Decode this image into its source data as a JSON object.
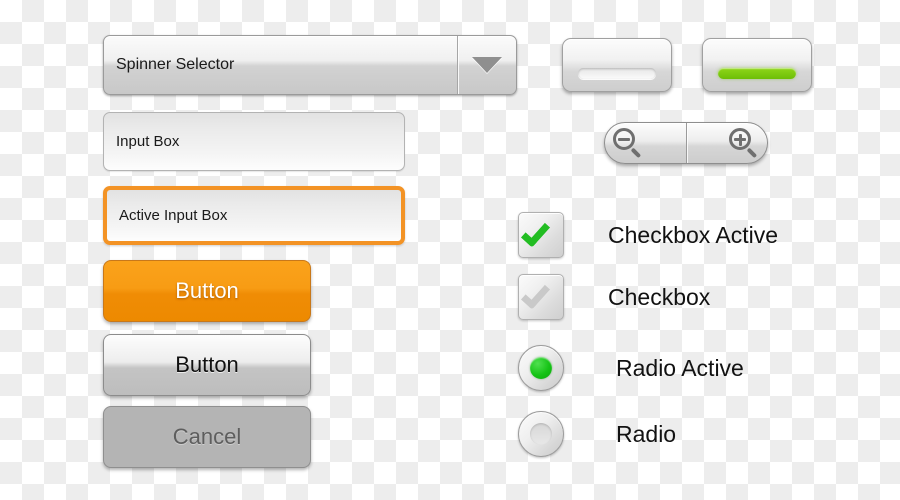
{
  "palette": {
    "accent_orange": "#f39325",
    "button_orange": "#f89c14",
    "accent_green": "#22bd22",
    "slider_green": "#7ecc10",
    "disabled_grey": "#b4b4b4",
    "text_dark": "#121212",
    "canvas_checker": "#ededed"
  },
  "spinner": {
    "label": "Spinner Selector",
    "arrow_icon": "chevron-down-icon"
  },
  "inputs": [
    {
      "value": "Input Box",
      "state": "normal"
    },
    {
      "value": "Active Input Box",
      "state": "active"
    }
  ],
  "buttons": [
    {
      "label": "Button",
      "style": "primary"
    },
    {
      "label": "Button",
      "style": "secondary"
    },
    {
      "label": "Cancel",
      "style": "disabled"
    }
  ],
  "sliders": [
    {
      "state": "off",
      "icon": "slider-handle-off-icon"
    },
    {
      "state": "on",
      "icon": "slider-handle-on-icon"
    }
  ],
  "zoom_control": {
    "zoom_out_icon": "magnifier-minus-icon",
    "zoom_in_icon": "magnifier-plus-icon"
  },
  "checkboxes": [
    {
      "label": "Checkbox Active",
      "checked": true
    },
    {
      "label": "Checkbox",
      "checked": false
    }
  ],
  "radios": [
    {
      "label": "Radio Active",
      "selected": true
    },
    {
      "label": "Radio",
      "selected": false
    }
  ]
}
